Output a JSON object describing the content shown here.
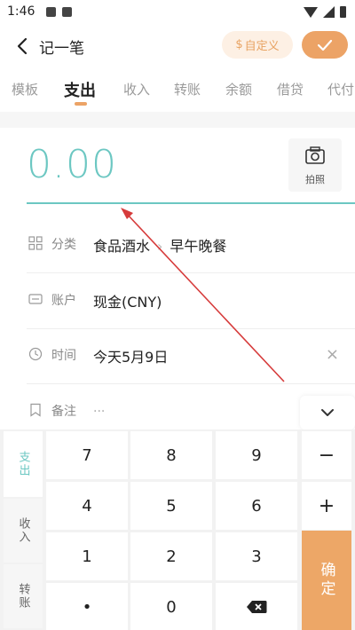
{
  "status_bar": {
    "time": "1:46"
  },
  "header": {
    "back_icon": "chevron-left-icon",
    "title": "记一笔",
    "custom_icon": "dollar-icon",
    "custom_label": "自定义",
    "confirm_icon": "check-icon"
  },
  "tabs": [
    {
      "label": "模板"
    },
    {
      "label": "支出"
    },
    {
      "label": "收入"
    },
    {
      "label": "转账"
    },
    {
      "label": "余额"
    },
    {
      "label": "借贷"
    },
    {
      "label": "代付"
    }
  ],
  "active_tab": "支出",
  "amount": {
    "value": "0.00",
    "photo_label": "拍照",
    "photo_icon": "camera-icon"
  },
  "form": {
    "category": {
      "label": "分类",
      "icon": "grid-icon",
      "main": "食品酒水",
      "sub": "早午晚餐"
    },
    "account": {
      "label": "账户",
      "icon": "wallet-icon",
      "value": "现金(CNY)"
    },
    "time": {
      "label": "时间",
      "icon": "clock-icon",
      "value": "今天5月9日",
      "clear": "×"
    },
    "note": {
      "label": "备注",
      "icon": "bookmark-icon",
      "value": "..."
    }
  },
  "keypad": {
    "side_tabs": [
      {
        "label": "支出",
        "active": true
      },
      {
        "label": "收入",
        "active": false
      },
      {
        "label": "转账",
        "active": false
      }
    ],
    "rows": [
      [
        "7",
        "8",
        "9"
      ],
      [
        "4",
        "5",
        "6"
      ],
      [
        "1",
        "2",
        "3"
      ],
      [
        "•",
        "0",
        ""
      ]
    ],
    "minus": "−",
    "plus": "+",
    "ok": "确定",
    "backspace_icon": "backspace-icon",
    "collapse_icon": "chevron-down-icon"
  },
  "colors": {
    "accent_teal": "#6cc7c2",
    "accent_orange": "#eca366",
    "annotation_red": "#d63b3b"
  }
}
